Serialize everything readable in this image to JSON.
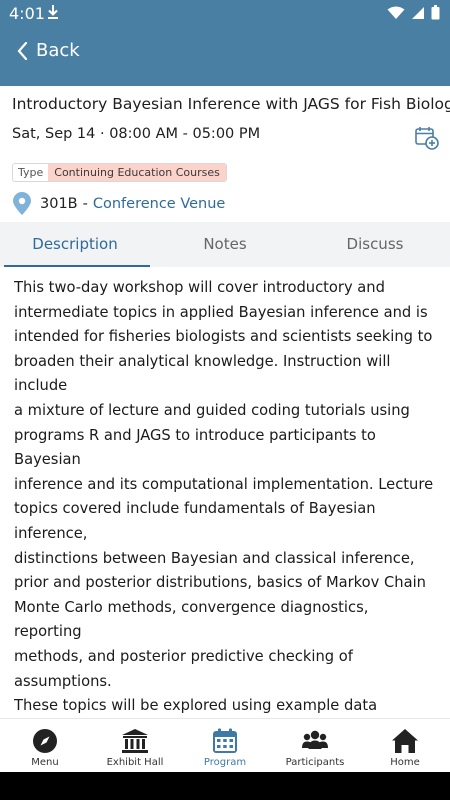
{
  "status_bar": {
    "time": "4:01"
  },
  "app_bar": {
    "back_label": "Back"
  },
  "session": {
    "title": "Introductory Bayesian Inference with JAGS for Fish Biologists",
    "datetime": "Sat, Sep 14 · 08:00 AM - 05:00 PM",
    "type_label": "Type",
    "type_value": "Continuing Education Courses",
    "room": "301B",
    "separator": "-",
    "venue": "Conference Venue"
  },
  "tabs": [
    {
      "label": "Description",
      "active": true
    },
    {
      "label": "Notes",
      "active": false
    },
    {
      "label": "Discuss",
      "active": false
    }
  ],
  "description": "This two-day workshop will cover introductory and\nintermediate topics in applied Bayesian inference and is\nintended for fisheries biologists and scientists seeking to\nbroaden their analytical knowledge. Instruction will include\na mixture of lecture and guided coding tutorials using\nprograms R and JAGS to introduce participants to Bayesian\ninference and its computational implementation. Lecture\ntopics covered include fundamentals of Bayesian inference,\ndistinctions between Bayesian and classical inference,\nprior and posterior distributions, basics of Markov Chain\nMonte Carlo methods, convergence diagnostics, reporting\nmethods, and posterior predictive checking of assumptions.\nThese topics will be explored using example data analyses\nthat range in complexity from basic means comparisons\nto general(ized) linear (mixed) models, concluding with\nstate-space expressions of Cormack-Jolly-Seber models.\nA refresher/overview of each model will be provided to\nensure participants understand the model prior to seeing its",
  "bottom_nav": [
    {
      "label": "Menu",
      "icon": "compass-icon",
      "active": false
    },
    {
      "label": "Exhibit Hall",
      "icon": "building-icon",
      "active": false
    },
    {
      "label": "Program",
      "icon": "calendar-icon",
      "active": true
    },
    {
      "label": "Participants",
      "icon": "people-icon",
      "active": false
    },
    {
      "label": "Home",
      "icon": "home-icon",
      "active": false
    }
  ],
  "colors": {
    "primary": "#4a7fa4",
    "link": "#2f6b9a",
    "type_badge_bg": "#fbd3cb",
    "tabs_bg": "#f2f3f5"
  }
}
